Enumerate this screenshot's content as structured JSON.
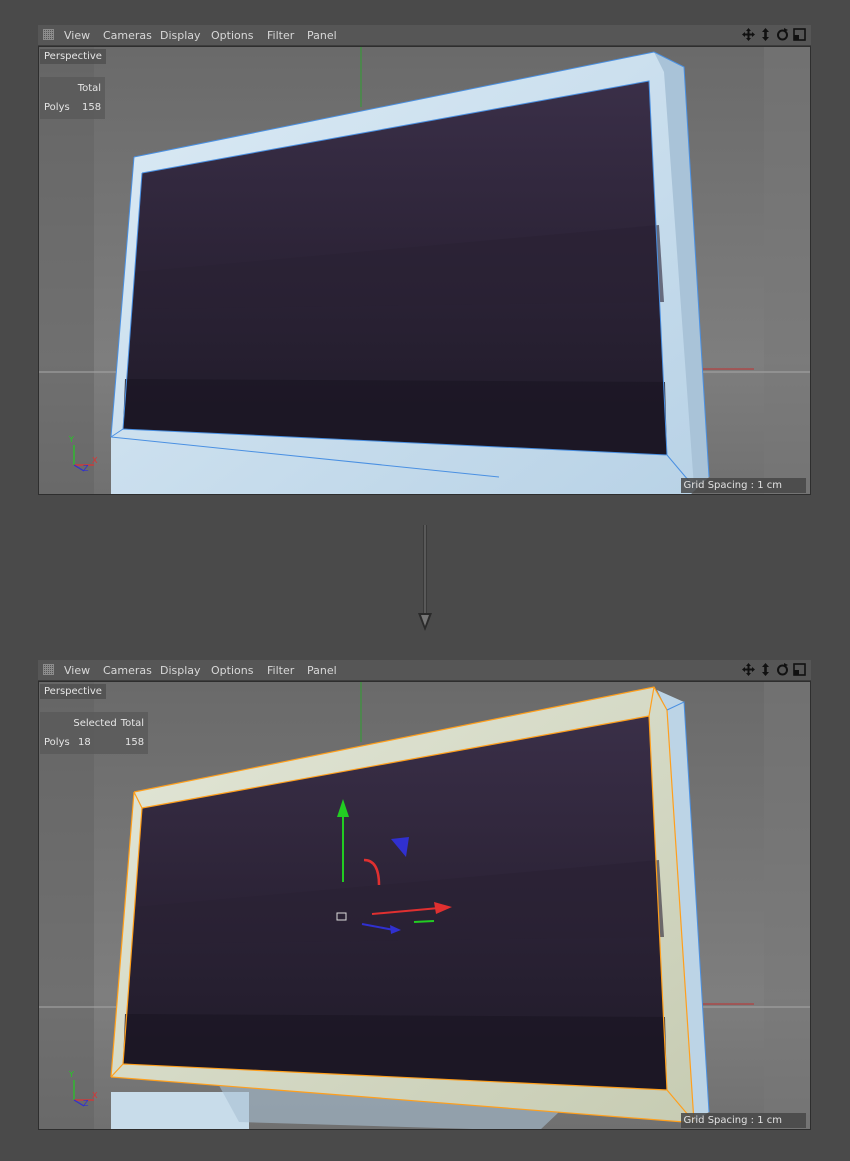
{
  "menu": [
    "View",
    "Cameras",
    "Display",
    "Options",
    "Filter",
    "Panel"
  ],
  "icons": [
    "move-icon",
    "dolly-icon",
    "rotate-icon",
    "maximize-icon"
  ],
  "viewport_top": {
    "label": "Perspective",
    "stats_header": "Total",
    "stats_row_label": "Polys",
    "stats_total": "158",
    "grid_spacing": "Grid Spacing : 1 cm"
  },
  "viewport_bottom": {
    "label": "Perspective",
    "stats_header_selected": "Selected",
    "stats_header_total": "Total",
    "stats_row_label": "Polys",
    "stats_selected": "18",
    "stats_total": "158",
    "grid_spacing": "Grid Spacing : 1 cm"
  },
  "colors": {
    "selection_highlight": "#ff9f1c",
    "edge_highlight": "#4a90e2",
    "axis_x": "#e03030",
    "axis_y": "#22cc22",
    "axis_z": "#3030d0"
  }
}
